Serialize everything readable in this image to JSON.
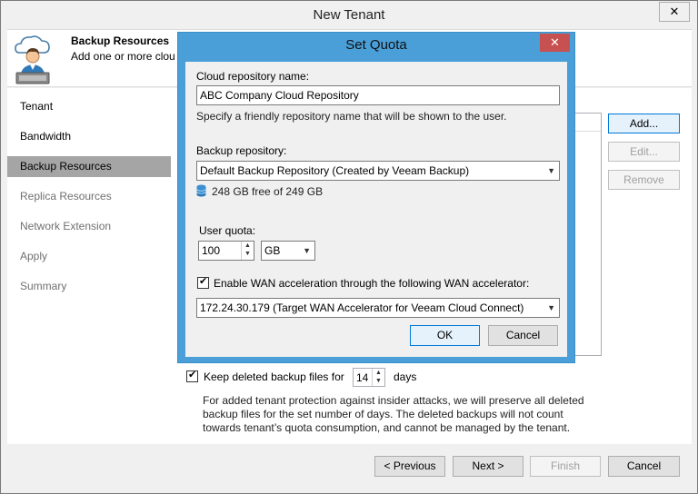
{
  "window": {
    "title": "New Tenant",
    "close_glyph": "✕"
  },
  "header": {
    "title": "Backup Resources",
    "subtitle": "Add one or more clou",
    "icon": "cloud-user-icon"
  },
  "nav": {
    "items": [
      {
        "label": "Tenant",
        "state": "normal"
      },
      {
        "label": "Bandwidth",
        "state": "normal"
      },
      {
        "label": "Backup Resources",
        "state": "active"
      },
      {
        "label": "Replica Resources",
        "state": "dim"
      },
      {
        "label": "Network Extension",
        "state": "dim"
      },
      {
        "label": "Apply",
        "state": "dim"
      },
      {
        "label": "Summary",
        "state": "dim"
      }
    ]
  },
  "side_buttons": {
    "add": "Add...",
    "edit": "Edit...",
    "remove": "Remove"
  },
  "keep": {
    "label": "Keep deleted backup files for",
    "value": "14",
    "unit": "days",
    "checked_glyph": "✔",
    "description": "For added tenant protection against insider attacks, we will preserve all deleted backup files for the set number of days. The deleted backups will not count towards tenant’s quota consumption, and cannot be managed by the tenant."
  },
  "footer": {
    "previous": "< Previous",
    "next": "Next >",
    "finish": "Finish",
    "cancel": "Cancel"
  },
  "modal": {
    "title": "Set Quota",
    "close_glyph": "✕",
    "repo_name_label": "Cloud repository name:",
    "repo_name_value": "ABC Company Cloud Repository",
    "repo_name_hint": "Specify a friendly repository name that will be shown to the user.",
    "backup_repo_label": "Backup repository:",
    "backup_repo_value": "Default Backup Repository (Created by Veeam Backup)",
    "free_space": "248 GB free of 249 GB",
    "quota_label": "User quota:",
    "quota_value": "100",
    "quota_unit": "GB",
    "wan_label": "Enable WAN acceleration through the following WAN accelerator:",
    "wan_checked_glyph": "✔",
    "wan_value": "172.24.30.179 (Target WAN Accelerator for Veeam Cloud Connect)",
    "ok": "OK",
    "cancel": "Cancel"
  },
  "colors": {
    "modal_frame": "#4a9fd9",
    "close_red": "#c75050",
    "nav_active": "#a5a5a5"
  }
}
